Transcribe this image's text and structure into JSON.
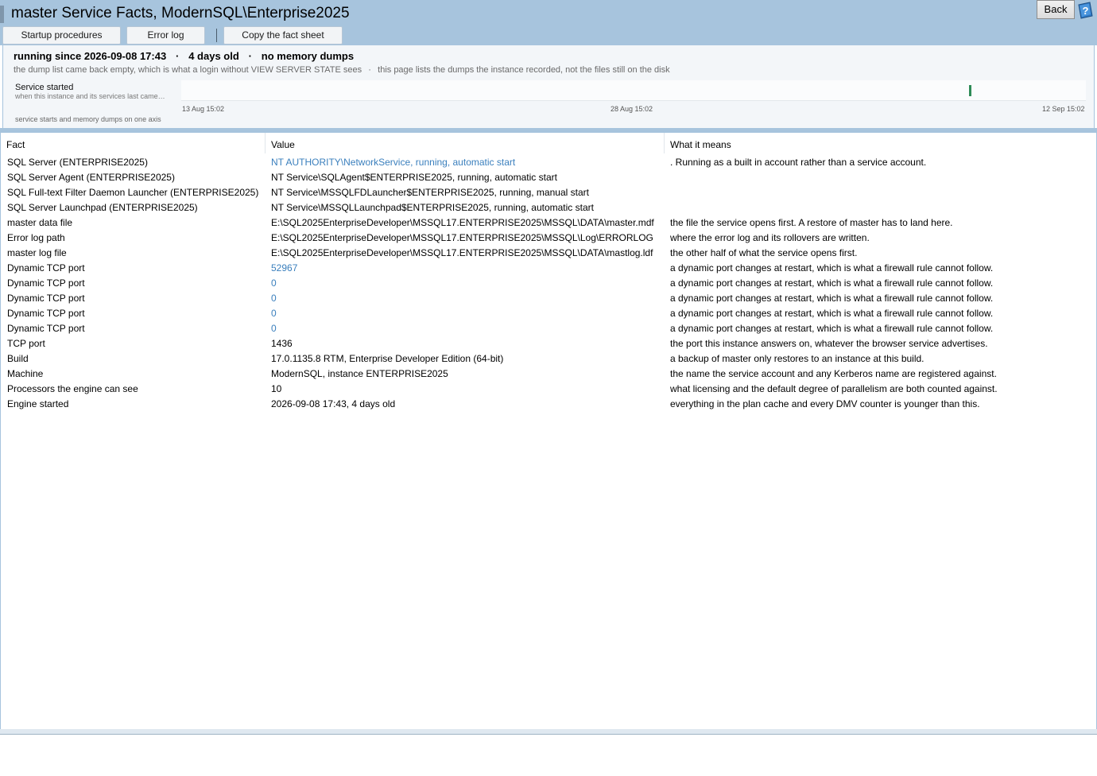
{
  "window": {
    "title": "master Service Facts, ModernSQL\\Enterprise2025",
    "back_label": "Back"
  },
  "toolbar": {
    "buttons": [
      "Startup procedures",
      "Error log",
      "Copy the fact sheet"
    ]
  },
  "summary": {
    "running_since": "running since 2026-09-08 17:43",
    "age": "4 days old",
    "dumps": "no memory dumps",
    "sep": "·",
    "note1": "the dump list came back empty, which is what a login without VIEW SERVER STATE sees",
    "note2": "this page lists the dumps the instance recorded, not the files still on the disk"
  },
  "timeline": {
    "label": "Service started",
    "sublabel": "when this instance and its services last came up",
    "ticks": [
      "13 Aug 15:02",
      "28 Aug 15:02",
      "12 Sep 15:02"
    ],
    "range_start": "2026-08-13 15:02",
    "range_end": "2026-09-12 15:02",
    "event": "2026-09-08 17:43",
    "marker_color": "#2e8b57",
    "footer": "service starts and memory dumps on one axis"
  },
  "table": {
    "headers": [
      "Fact",
      "Value",
      "What it means"
    ],
    "rows": [
      {
        "fact": "SQL Server (ENTERPRISE2025)",
        "value": "NT AUTHORITY\\NetworkService, running, automatic start",
        "link": true,
        "meaning": ". Running as a built in account rather than a service account."
      },
      {
        "fact": "SQL Server Agent (ENTERPRISE2025)",
        "value": "NT Service\\SQLAgent$ENTERPRISE2025, running, automatic start",
        "link": false,
        "meaning": ""
      },
      {
        "fact": "SQL Full-text Filter Daemon Launcher (ENTERPRISE2025)",
        "value": "NT Service\\MSSQLFDLauncher$ENTERPRISE2025, running, manual start",
        "link": false,
        "meaning": ""
      },
      {
        "fact": "SQL Server Launchpad (ENTERPRISE2025)",
        "value": "NT Service\\MSSQLLaunchpad$ENTERPRISE2025, running, automatic start",
        "link": false,
        "meaning": ""
      },
      {
        "fact": "master data file",
        "value": "E:\\SQL2025EnterpriseDeveloper\\MSSQL17.ENTERPRISE2025\\MSSQL\\DATA\\master.mdf",
        "link": false,
        "meaning": "the file the service opens first. A restore of master has to land here."
      },
      {
        "fact": "Error log path",
        "value": "E:\\SQL2025EnterpriseDeveloper\\MSSQL17.ENTERPRISE2025\\MSSQL\\Log\\ERRORLOG",
        "link": false,
        "meaning": "where the error log and its rollovers are written."
      },
      {
        "fact": "master log file",
        "value": "E:\\SQL2025EnterpriseDeveloper\\MSSQL17.ENTERPRISE2025\\MSSQL\\DATA\\mastlog.ldf",
        "link": false,
        "meaning": "the other half of what the service opens first."
      },
      {
        "fact": "Dynamic TCP port",
        "value": "52967",
        "link": true,
        "meaning": "a dynamic port changes at restart, which is what a firewall rule cannot follow."
      },
      {
        "fact": "Dynamic TCP port",
        "value": "0",
        "link": true,
        "meaning": "a dynamic port changes at restart, which is what a firewall rule cannot follow."
      },
      {
        "fact": "Dynamic TCP port",
        "value": "0",
        "link": true,
        "meaning": "a dynamic port changes at restart, which is what a firewall rule cannot follow."
      },
      {
        "fact": "Dynamic TCP port",
        "value": "0",
        "link": true,
        "meaning": "a dynamic port changes at restart, which is what a firewall rule cannot follow."
      },
      {
        "fact": "Dynamic TCP port",
        "value": "0",
        "link": true,
        "meaning": "a dynamic port changes at restart, which is what a firewall rule cannot follow."
      },
      {
        "fact": "TCP port",
        "value": "1436",
        "link": false,
        "meaning": "the port this instance answers on, whatever the browser service advertises."
      },
      {
        "fact": "Build",
        "value": "17.0.1135.8 RTM, Enterprise Developer Edition (64-bit)",
        "link": false,
        "meaning": "a backup of master only restores to an instance at this build."
      },
      {
        "fact": "Machine",
        "value": "ModernSQL, instance ENTERPRISE2025",
        "link": false,
        "meaning": "the name the service account and any Kerberos name are registered against."
      },
      {
        "fact": "Processors the engine can see",
        "value": "10",
        "link": false,
        "meaning": "what licensing and the default degree of parallelism are both counted against."
      },
      {
        "fact": "Engine started",
        "value": "2026-09-08 17:43, 4 days old",
        "link": false,
        "meaning": "everything in the plan cache and every DMV counter is younger than this."
      }
    ]
  },
  "colors": {
    "frame": "#a7c4dd",
    "link": "#3a7fbd"
  }
}
